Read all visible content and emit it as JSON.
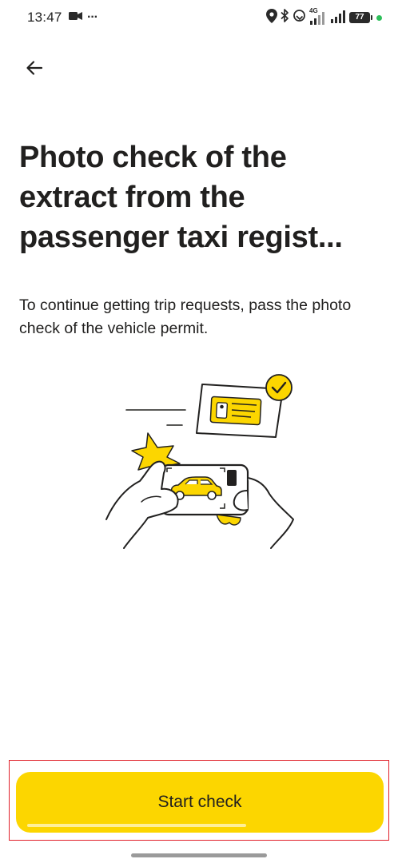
{
  "status_bar": {
    "time": "13:47",
    "more_indicator": "···",
    "network_label": "4G",
    "battery_level": "77",
    "icons": [
      "video-camera-icon",
      "location-icon",
      "bluetooth-icon",
      "link-icon",
      "signal-icon",
      "battery-icon"
    ]
  },
  "header": {
    "back_icon": "arrow-left-icon"
  },
  "main": {
    "title": "Photo check of the extract from the passenger taxi regist...",
    "subtitle": "To continue getting trip requests, pass the photo check of the vehicle permit.",
    "illustration": "hands-holding-phone-photographing-car-document-icon"
  },
  "footer": {
    "start_button_label": "Start check"
  },
  "colors": {
    "accent": "#fcd600",
    "text": "#21201f",
    "background": "#ffffff",
    "check_badge": "#fcd600",
    "highlight_outline": "#e0202a"
  }
}
